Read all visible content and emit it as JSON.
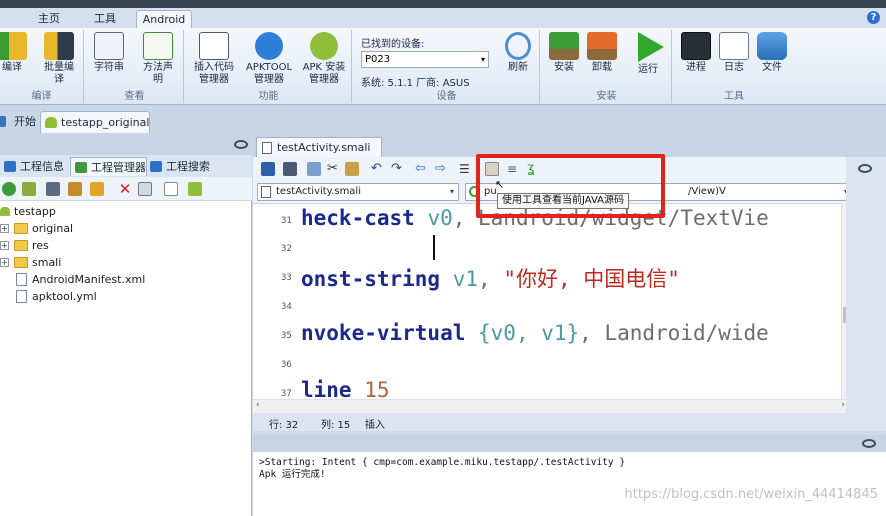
{
  "menu_tabs": [
    "主页",
    "工具",
    "Android"
  ],
  "help_label": "?",
  "ribbon": {
    "groups": [
      {
        "label": "编译",
        "buttons": [
          "编译",
          "批量编\n译"
        ]
      },
      {
        "label": "查看",
        "buttons": [
          "字符串",
          "方法声\n明"
        ]
      },
      {
        "label": "功能",
        "buttons": [
          "插入代码\n管理器",
          "APKTOOL\n管理器",
          "APK 安装\n管理器"
        ]
      },
      {
        "label": "设备",
        "device_found_label": "已找到的设备:",
        "device_value": "P023",
        "system_info": "系统: 5.1.1  厂商: ASUS",
        "buttons": [
          "刷新"
        ]
      },
      {
        "label": "安装",
        "buttons": [
          "安装",
          "卸载",
          "运行"
        ]
      },
      {
        "label": "工具",
        "buttons": [
          "进程",
          "日志",
          "文件"
        ]
      }
    ]
  },
  "doc_tabs": [
    "开始",
    "testapp_original"
  ],
  "left_panel": {
    "tabs": [
      "工程信息",
      "工程管理器",
      "工程搜索"
    ],
    "tree": [
      {
        "label": "testapp",
        "kind": "root"
      },
      {
        "label": "original",
        "kind": "folder"
      },
      {
        "label": "res",
        "kind": "folder"
      },
      {
        "label": "smali",
        "kind": "folder"
      },
      {
        "label": "AndroidManifest.xml",
        "kind": "file"
      },
      {
        "label": "apktool.yml",
        "kind": "file"
      }
    ]
  },
  "editor": {
    "tab_title": "testActivity.smali",
    "file_select": "testActivity.smali",
    "method_select_prefix": "pu",
    "method_select_suffix": "/View)V",
    "tooltip": "使用工具查看当前JAVA源码",
    "lines": [
      {
        "num": "31",
        "kw": "heck-cast",
        "reg": " v0",
        "rest": ", Landroid/widget/TextVie"
      },
      {
        "num": "32",
        "kw": "",
        "reg": "",
        "rest": ""
      },
      {
        "num": "33",
        "kw": "onst-string",
        "reg": " v1",
        "rest": ", ",
        "str": "\"你好, 中国电信\""
      },
      {
        "num": "34",
        "kw": "",
        "reg": "",
        "rest": ""
      },
      {
        "num": "35",
        "kw": "nvoke-virtual",
        "reg": " {v0, v1}",
        "rest": ", Landroid/wide"
      },
      {
        "num": "36",
        "kw": "",
        "reg": "",
        "rest": ""
      },
      {
        "num": "37",
        "kw": "line",
        "reg": " 15",
        "rest": ""
      }
    ],
    "status": {
      "line": "行: 32",
      "col": "列: 15",
      "mode": "插入"
    }
  },
  "output": {
    "lines": [
      ">Starting: Intent { cmp=com.example.miku.testapp/.testActivity }",
      "Apk 运行完成!"
    ]
  },
  "watermark": "https://blog.csdn.net/weixin_44414845",
  "colors": {
    "highlight": "#e2231a",
    "ribbon_bg": "#dde7f3",
    "keyword": "#1a2a8a",
    "string": "#c0281e",
    "register": "#4a9a9e"
  }
}
